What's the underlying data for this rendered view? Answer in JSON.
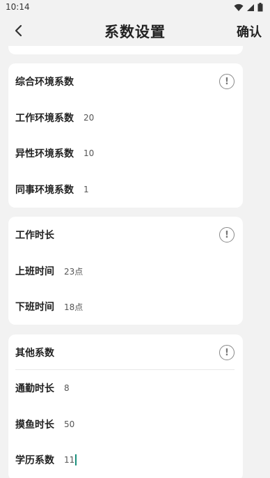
{
  "status": {
    "time": "10:14"
  },
  "nav": {
    "title": "系数设置",
    "confirm": "确认"
  },
  "sections": [
    {
      "title": "综合环境系数",
      "rows": [
        {
          "label": "工作环境系数",
          "value": "20"
        },
        {
          "label": "异性环境系数",
          "value": "10"
        },
        {
          "label": "同事环境系数",
          "value": "1"
        }
      ]
    },
    {
      "title": "工作时长",
      "rows": [
        {
          "label": "上班时间",
          "value": "23点"
        },
        {
          "label": "下班时间",
          "value": "18点"
        }
      ]
    },
    {
      "title": "其他系数",
      "rows": [
        {
          "label": "通勤时长",
          "value": "8"
        },
        {
          "label": "摸鱼时长",
          "value": "50"
        },
        {
          "label": "学历系数",
          "value": "11"
        }
      ]
    }
  ],
  "colors": {
    "background": "#f2f2f2",
    "card": "#ffffff",
    "caret": "#1a8f7c"
  },
  "icons": {
    "back": "chevron-left-icon",
    "info": "info-circle-icon"
  }
}
